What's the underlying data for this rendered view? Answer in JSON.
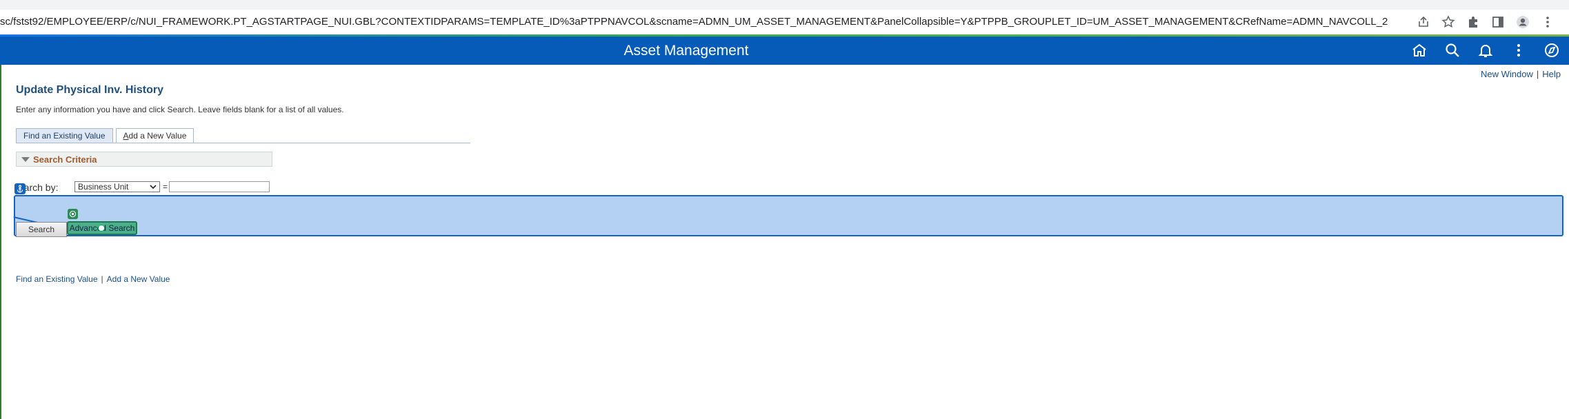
{
  "browser": {
    "url": "sc/fstst92/EMPLOYEE/ERP/c/NUI_FRAMEWORK.PT_AGSTARTPAGE_NUI.GBL?CONTEXTIDPARAMS=TEMPLATE_ID%3aPTPPNAVCOL&scname=ADMN_UM_ASSET_MANAGEMENT&PanelCollapsible=Y&PTPPB_GROUPLET_ID=UM_ASSET_MANAGEMENT&CRefName=ADMN_NAVCOLL_2",
    "icons": [
      "share-icon",
      "star-icon",
      "extensions-icon",
      "sidepanel-icon",
      "profile-icon",
      "menu-icon"
    ]
  },
  "header": {
    "title": "Asset Management",
    "icons": [
      "home-icon",
      "search-icon",
      "bell-icon",
      "more-icon",
      "navbar-icon"
    ]
  },
  "util": {
    "new_window": "New Window",
    "help": "Help",
    "sep": "|"
  },
  "page": {
    "title": "Update Physical Inv. History",
    "instructions": "Enter any information you have and click Search. Leave fields blank for a list of all values."
  },
  "tabs": {
    "find": "Find an Existing Value",
    "add_prefix": "A",
    "add_rest": "dd a New Value"
  },
  "criteria": {
    "label": "Search Criteria"
  },
  "search_by": {
    "label_rest": "earch by:",
    "selected": "Business Unit",
    "equals": "=",
    "value": ""
  },
  "buttons": {
    "search": "Search",
    "advanced": "Advanced Search"
  },
  "bottom_links": {
    "find": "Find an Existing Value",
    "add": "Add a New Value",
    "sep": "|"
  },
  "colors": {
    "header_bg": "#065bb8",
    "overlay": "#b4d0f2",
    "overlay_border": "#1565c0",
    "adv_btn": "#4caf8a"
  }
}
